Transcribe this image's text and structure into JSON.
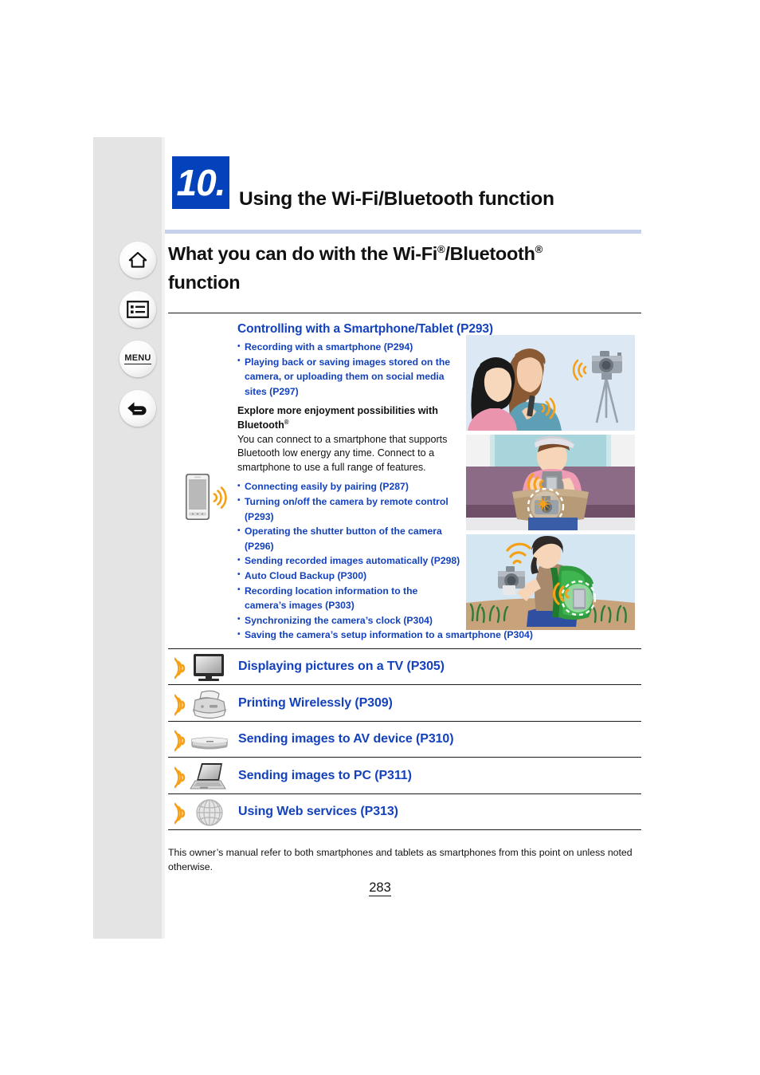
{
  "sidebar": {
    "items": [
      {
        "name": "home",
        "icon": "home-icon",
        "label": ""
      },
      {
        "name": "contents",
        "icon": "list-icon",
        "label": ""
      },
      {
        "name": "menu",
        "icon": "menu-text-icon",
        "label": "MENU"
      },
      {
        "name": "back",
        "icon": "back-arrow-icon",
        "label": ""
      }
    ]
  },
  "chapter": {
    "number": "10.",
    "title": "Using the Wi-Fi/Bluetooth function",
    "badge_color": "#0342ba"
  },
  "heading": {
    "line1_a": "What you can do with the Wi-Fi",
    "line1_sup1": "®",
    "line1_b": "/Bluetooth",
    "line1_sup2": "®",
    "line2": "function"
  },
  "smartphone_section": {
    "title": "Controlling with a Smartphone/Tablet (P293)",
    "top_links": [
      "Recording with a smartphone (P294)",
      "Playing back or saving images stored on the camera, or uploading them on social media sites (P297)"
    ],
    "bluetooth_heading_a": "Explore more enjoyment possibilities with Bluetooth",
    "bluetooth_heading_sup": "®",
    "bluetooth_body": "You can connect to a smartphone that supports Bluetooth low energy any time. Connect to a smartphone to use a full range of features.",
    "bluetooth_links": [
      "Connecting easily by pairing (P287)",
      "Turning on/off the camera by remote control (P293)",
      "Operating the shutter button of the camera (P296)",
      "Sending recorded images automatically (P298)",
      "Auto Cloud Backup (P300)",
      "Recording location information to the camera’s images (P303)",
      "Synchronizing the camera’s clock (P304)"
    ],
    "bluetooth_link_wide": "Saving the camera’s setup information to a smartphone (P304)",
    "phone_icon": "smartphone-wireless-icon",
    "illustrations": [
      "two-women-smartphone-camera-tripod-illustration",
      "person-on-train-smartphone-camera-in-bag-illustration",
      "hiker-camera-green-backpack-smartphone-illustration"
    ]
  },
  "device_rows": [
    {
      "icon": "tv-icon",
      "label": "Displaying pictures on a TV (P305)"
    },
    {
      "icon": "printer-icon",
      "label": "Printing Wirelessly (P309)"
    },
    {
      "icon": "av-device-icon",
      "label": "Sending images to AV device (P310)"
    },
    {
      "icon": "laptop-icon",
      "label": "Sending images to PC (P311)"
    },
    {
      "icon": "globe-icon",
      "label": "Using Web services (P313)"
    }
  ],
  "footnote": "This owner’s manual refer to both smartphones and tablets as smartphones from this point on unless noted otherwise.",
  "page_number": "283",
  "colors": {
    "link_blue": "#1442bd",
    "badge_blue": "#0342ba",
    "rule_blue": "#c5d0ea",
    "wireless_orange": "#f5a017",
    "panel_gray": "#e4e4e4"
  }
}
